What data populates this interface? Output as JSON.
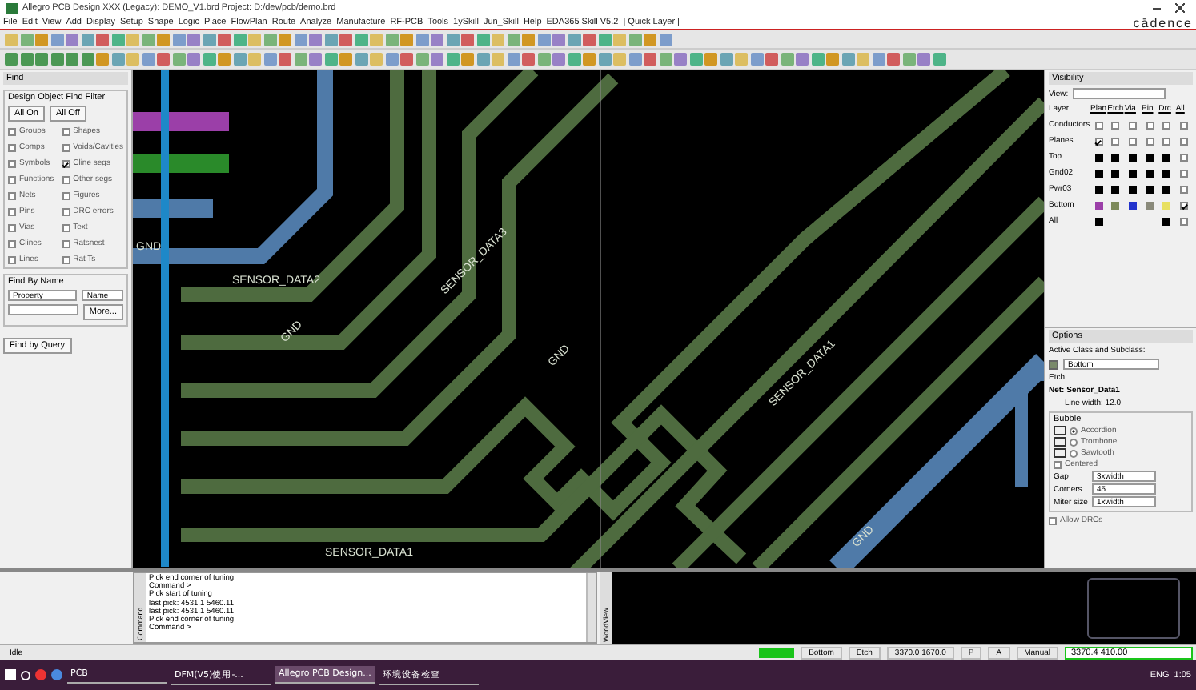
{
  "window": {
    "title": "Allegro PCB Design XXX (Legacy): DEMO_V1.brd  Project: D:/dev/pcb/demo.brd",
    "logo": "cādence"
  },
  "menu": [
    "File",
    "Edit",
    "View",
    "Add",
    "Display",
    "Setup",
    "Shape",
    "Logic",
    "Place",
    "FlowPlan",
    "Route",
    "Analyze",
    "Manufacture",
    "RF-PCB",
    "Tools",
    "1ySkill",
    "Jun_Skill",
    "Help",
    "EDA365 Skill V5.2",
    "| Quick Layer |"
  ],
  "find_panel": {
    "title": "Find",
    "filter_title": "Design Object Find Filter",
    "buttons": [
      "All On",
      "All Off"
    ],
    "objects": [
      {
        "label": "Groups",
        "checked": false
      },
      {
        "label": "Shapes",
        "checked": false
      },
      {
        "label": "Comps",
        "checked": false
      },
      {
        "label": "Voids/Cavities",
        "checked": false
      },
      {
        "label": "Symbols",
        "checked": false
      },
      {
        "label": "Cline segs",
        "checked": true
      },
      {
        "label": "Functions",
        "checked": false
      },
      {
        "label": "Other segs",
        "checked": false
      },
      {
        "label": "Nets",
        "checked": false
      },
      {
        "label": "Figures",
        "checked": false
      },
      {
        "label": "Pins",
        "checked": false
      },
      {
        "label": "DRC errors",
        "checked": false
      },
      {
        "label": "Vias",
        "checked": false
      },
      {
        "label": "Text",
        "checked": false
      },
      {
        "label": "Clines",
        "checked": false
      },
      {
        "label": "Ratsnest",
        "checked": false
      },
      {
        "label": "Lines",
        "checked": false
      },
      {
        "label": "Rat Ts",
        "checked": false
      }
    ],
    "by_name": {
      "title": "Find By Name",
      "type": "Property",
      "mode": "Name",
      "more": "More..."
    },
    "query_button": "Find by Query"
  },
  "canvas": {
    "trace_labels": [
      "GND",
      "SENSOR_DATA1",
      "GND",
      "SENSOR_DATA2",
      "SENSOR_DATA3",
      "GND",
      "SENSOR_DATA1",
      "GND"
    ]
  },
  "visibility": {
    "title": "Visibility",
    "view_label": "View:",
    "layer_label": "Layer",
    "columns": [
      "Plan",
      "Etch",
      "Via",
      "Pin",
      "Drc",
      "All"
    ],
    "rows": [
      {
        "name": "Conductors",
        "kind": "checks",
        "cells": [
          false,
          false,
          false,
          false,
          false,
          false
        ]
      },
      {
        "name": "Planes",
        "kind": "checks",
        "cells": [
          true,
          false,
          false,
          false,
          false,
          false
        ]
      },
      {
        "name": "Top",
        "kind": "swatches",
        "cells": [
          {
            "color": "#000000"
          },
          {
            "color": "#000000"
          },
          {
            "color": "#000000"
          },
          {
            "color": "#000000"
          },
          {
            "color": "#000000"
          }
        ],
        "all": false
      },
      {
        "name": "Gnd02",
        "kind": "swatches",
        "cells": [
          {
            "color": "#000000"
          },
          {
            "color": "#000000"
          },
          {
            "color": "#000000"
          },
          {
            "color": "#000000"
          },
          {
            "color": "#000000"
          }
        ],
        "all": false
      },
      {
        "name": "Pwr03",
        "kind": "swatches",
        "cells": [
          {
            "color": "#000000"
          },
          {
            "color": "#000000"
          },
          {
            "color": "#000000"
          },
          {
            "color": "#000000"
          },
          {
            "color": "#000000"
          }
        ],
        "all": false
      },
      {
        "name": "Bottom",
        "kind": "swatches",
        "cells": [
          {
            "color": "#9b3fa8"
          },
          {
            "color": "#7d8a5a"
          },
          {
            "color": "#2233cc"
          },
          {
            "color": "#8a8a7a"
          },
          {
            "color": "#e8e060"
          }
        ],
        "all": true
      },
      {
        "name": "All",
        "kind": "swatches",
        "cells": [
          {
            "color": "#000000"
          },
          null,
          null,
          null,
          {
            "color": "#000000"
          }
        ],
        "all": false
      }
    ]
  },
  "options": {
    "title": "Options",
    "class_label": "Active Class and Subclass:",
    "class": "Etch",
    "subclass": "Bottom",
    "net": "Net: Sensor_Data1",
    "line": "Line width: 12.0",
    "bubble_title": "Bubble",
    "bubble": [
      {
        "label": "Accordion",
        "selected": true
      },
      {
        "label": "Trombone",
        "selected": false
      },
      {
        "label": "Sawtooth",
        "selected": false
      }
    ],
    "centered": {
      "label": "Centered",
      "checked": false
    },
    "fields": [
      {
        "label": "Gap",
        "value": "3xwidth"
      },
      {
        "label": "Corners",
        "value": "45"
      },
      {
        "label": "Miter size",
        "value": "1xwidth"
      }
    ],
    "allow_drcs": {
      "label": "Allow DRCs",
      "checked": false
    }
  },
  "console": {
    "side_label": "Command",
    "lines": [
      "Pick end corner of tuning",
      "Command >",
      "Pick start of tuning",
      "last pick:  4531.1 5460.11",
      "last pick:  4531.1 5460.11",
      "Pick end corner of tuning",
      "Command >"
    ]
  },
  "world_view": {
    "side_label": "WorldView"
  },
  "status_bar": {
    "state": "Idle",
    "items": [
      "Bottom",
      "Etch",
      "3370.0 1670.0",
      "P",
      "A",
      "Manual"
    ],
    "coords": "3370.4 410.00"
  },
  "taskbar": {
    "apps": [
      {
        "label": "PCB",
        "selected": false
      },
      {
        "label": "DFM(V5)使用-...",
        "selected": false
      },
      {
        "label": "Allegro PCB Design...",
        "selected": true
      },
      {
        "label": "环境设备检查",
        "selected": false
      }
    ],
    "lang": "ENG",
    "time": "1:05"
  }
}
